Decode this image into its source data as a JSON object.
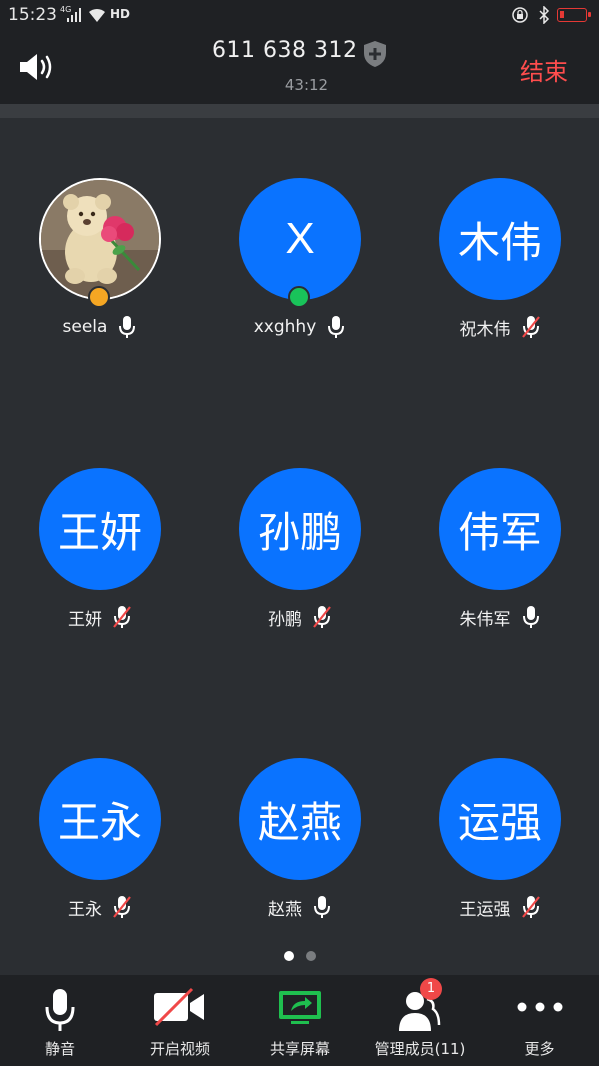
{
  "status_bar": {
    "time": "15:23",
    "network": "4G",
    "hd": "HD"
  },
  "call": {
    "meeting_id": "611 638 312",
    "timer": "43:12",
    "end_label": "结束"
  },
  "participants": [
    {
      "avatar_text": "",
      "avatar_type": "photo",
      "name": "seela",
      "mic": "on",
      "badge": "orange"
    },
    {
      "avatar_text": "X",
      "avatar_type": "letter",
      "name": "xxghhy",
      "mic": "on",
      "badge": "green"
    },
    {
      "avatar_text": "木伟",
      "avatar_type": "text",
      "name": "祝木伟",
      "mic": "muted",
      "badge": ""
    },
    {
      "avatar_text": "王妍",
      "avatar_type": "text",
      "name": "王妍",
      "mic": "muted",
      "badge": ""
    },
    {
      "avatar_text": "孙鹏",
      "avatar_type": "text",
      "name": "孙鹏",
      "mic": "muted",
      "badge": ""
    },
    {
      "avatar_text": "伟军",
      "avatar_type": "text",
      "name": "朱伟军",
      "mic": "on",
      "badge": ""
    },
    {
      "avatar_text": "王永",
      "avatar_type": "text",
      "name": "王永",
      "mic": "muted",
      "badge": ""
    },
    {
      "avatar_text": "赵燕",
      "avatar_type": "text",
      "name": "赵燕",
      "mic": "on",
      "badge": ""
    },
    {
      "avatar_text": "运强",
      "avatar_type": "text",
      "name": "王运强",
      "mic": "muted",
      "badge": ""
    }
  ],
  "pagination": {
    "pages": 2,
    "current": 1
  },
  "toolbar": {
    "mute_label": "静音",
    "video_label": "开启视频",
    "share_label": "共享屏幕",
    "members_label": "管理成员(11)",
    "members_badge": "1",
    "more_label": "更多"
  },
  "colors": {
    "avatar_blue": "#0a73ff",
    "end_red": "#ff4d4d",
    "share_green": "#1fbf4f",
    "muted_red": "#f04848"
  }
}
